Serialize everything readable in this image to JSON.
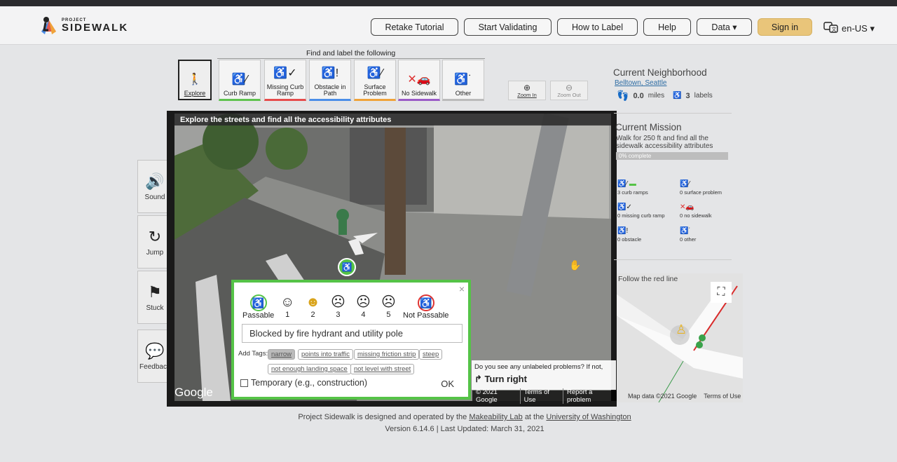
{
  "nav": {
    "logo_small": "PROJECT",
    "logo_big": "SIDEWALK",
    "buttons": [
      "Retake Tutorial",
      "Start Validating",
      "How to Label",
      "Help",
      "Data ▾"
    ],
    "signin": "Sign in",
    "language": "en-US ▾"
  },
  "toolbar": {
    "heading": "Find and label the following",
    "tools": [
      {
        "label": "Explore",
        "color": "#222222"
      },
      {
        "label": "Curb Ramp",
        "color": "#5fc24f"
      },
      {
        "label": "Missing Curb Ramp",
        "color": "#e64c4c"
      },
      {
        "label": "Obstacle in Path",
        "color": "#4b8ee8"
      },
      {
        "label": "Surface Problem",
        "color": "#f0a33a"
      },
      {
        "label": "No Sidewalk",
        "color": "#9b5cc7"
      },
      {
        "label": "Other",
        "color": "#bbbbbb"
      }
    ],
    "zoom_in": "Zoom In",
    "zoom_out": "Zoom Out"
  },
  "side_buttons": [
    "Sound",
    "Jump",
    "Stuck",
    "Feedback"
  ],
  "streetview": {
    "banner": "Explore the streets and find all the accessibility attributes",
    "google_logo": "Google",
    "footer": [
      "© 2021 Google",
      "Terms of Use",
      "Report a problem"
    ],
    "question": "Do you see any unlabeled problems? If not,",
    "turn": "Turn right"
  },
  "label_popup": {
    "severity": [
      "Passable",
      "1",
      "2",
      "3",
      "4",
      "5",
      "Not Passable"
    ],
    "description": "Blocked by fire hydrant and utility pole",
    "add_tags_label": "Add Tags:",
    "tags": [
      "narrow",
      "points into traffic",
      "missing friction strip",
      "steep",
      "not enough landing space",
      "not level with street"
    ],
    "selected_tag": "narrow",
    "temporary": "Temporary (e.g., construction)",
    "ok": "OK"
  },
  "right_panel": {
    "neighborhood_title": "Current Neighborhood",
    "neighborhood_name": "Belltown, Seattle",
    "miles": "0.0",
    "miles_unit": "miles",
    "labels": "3",
    "labels_unit": "labels",
    "mission_title": "Current Mission",
    "mission_desc": "Walk for 250 ft and find all the sidewalk accessibility attributes",
    "progress_text": "0% complete",
    "progress_value": 0,
    "stats": [
      "3 curb ramps",
      "0 surface problem",
      "0 missing curb ramp",
      "0 no sidewalk",
      "0 obstacle",
      "0 other"
    ],
    "map_hint": "Follow the red line",
    "map_footer": [
      "Map data ©2021 Google",
      "Terms of Use"
    ]
  },
  "footer": {
    "line1_a": "Project Sidewalk is designed and operated by the",
    "line1_link1": "Makeability Lab",
    "line1_b": "at the",
    "line1_link2": "University of Washington",
    "line2": "Version 6.14.6 | Last Updated: March 31, 2021"
  }
}
